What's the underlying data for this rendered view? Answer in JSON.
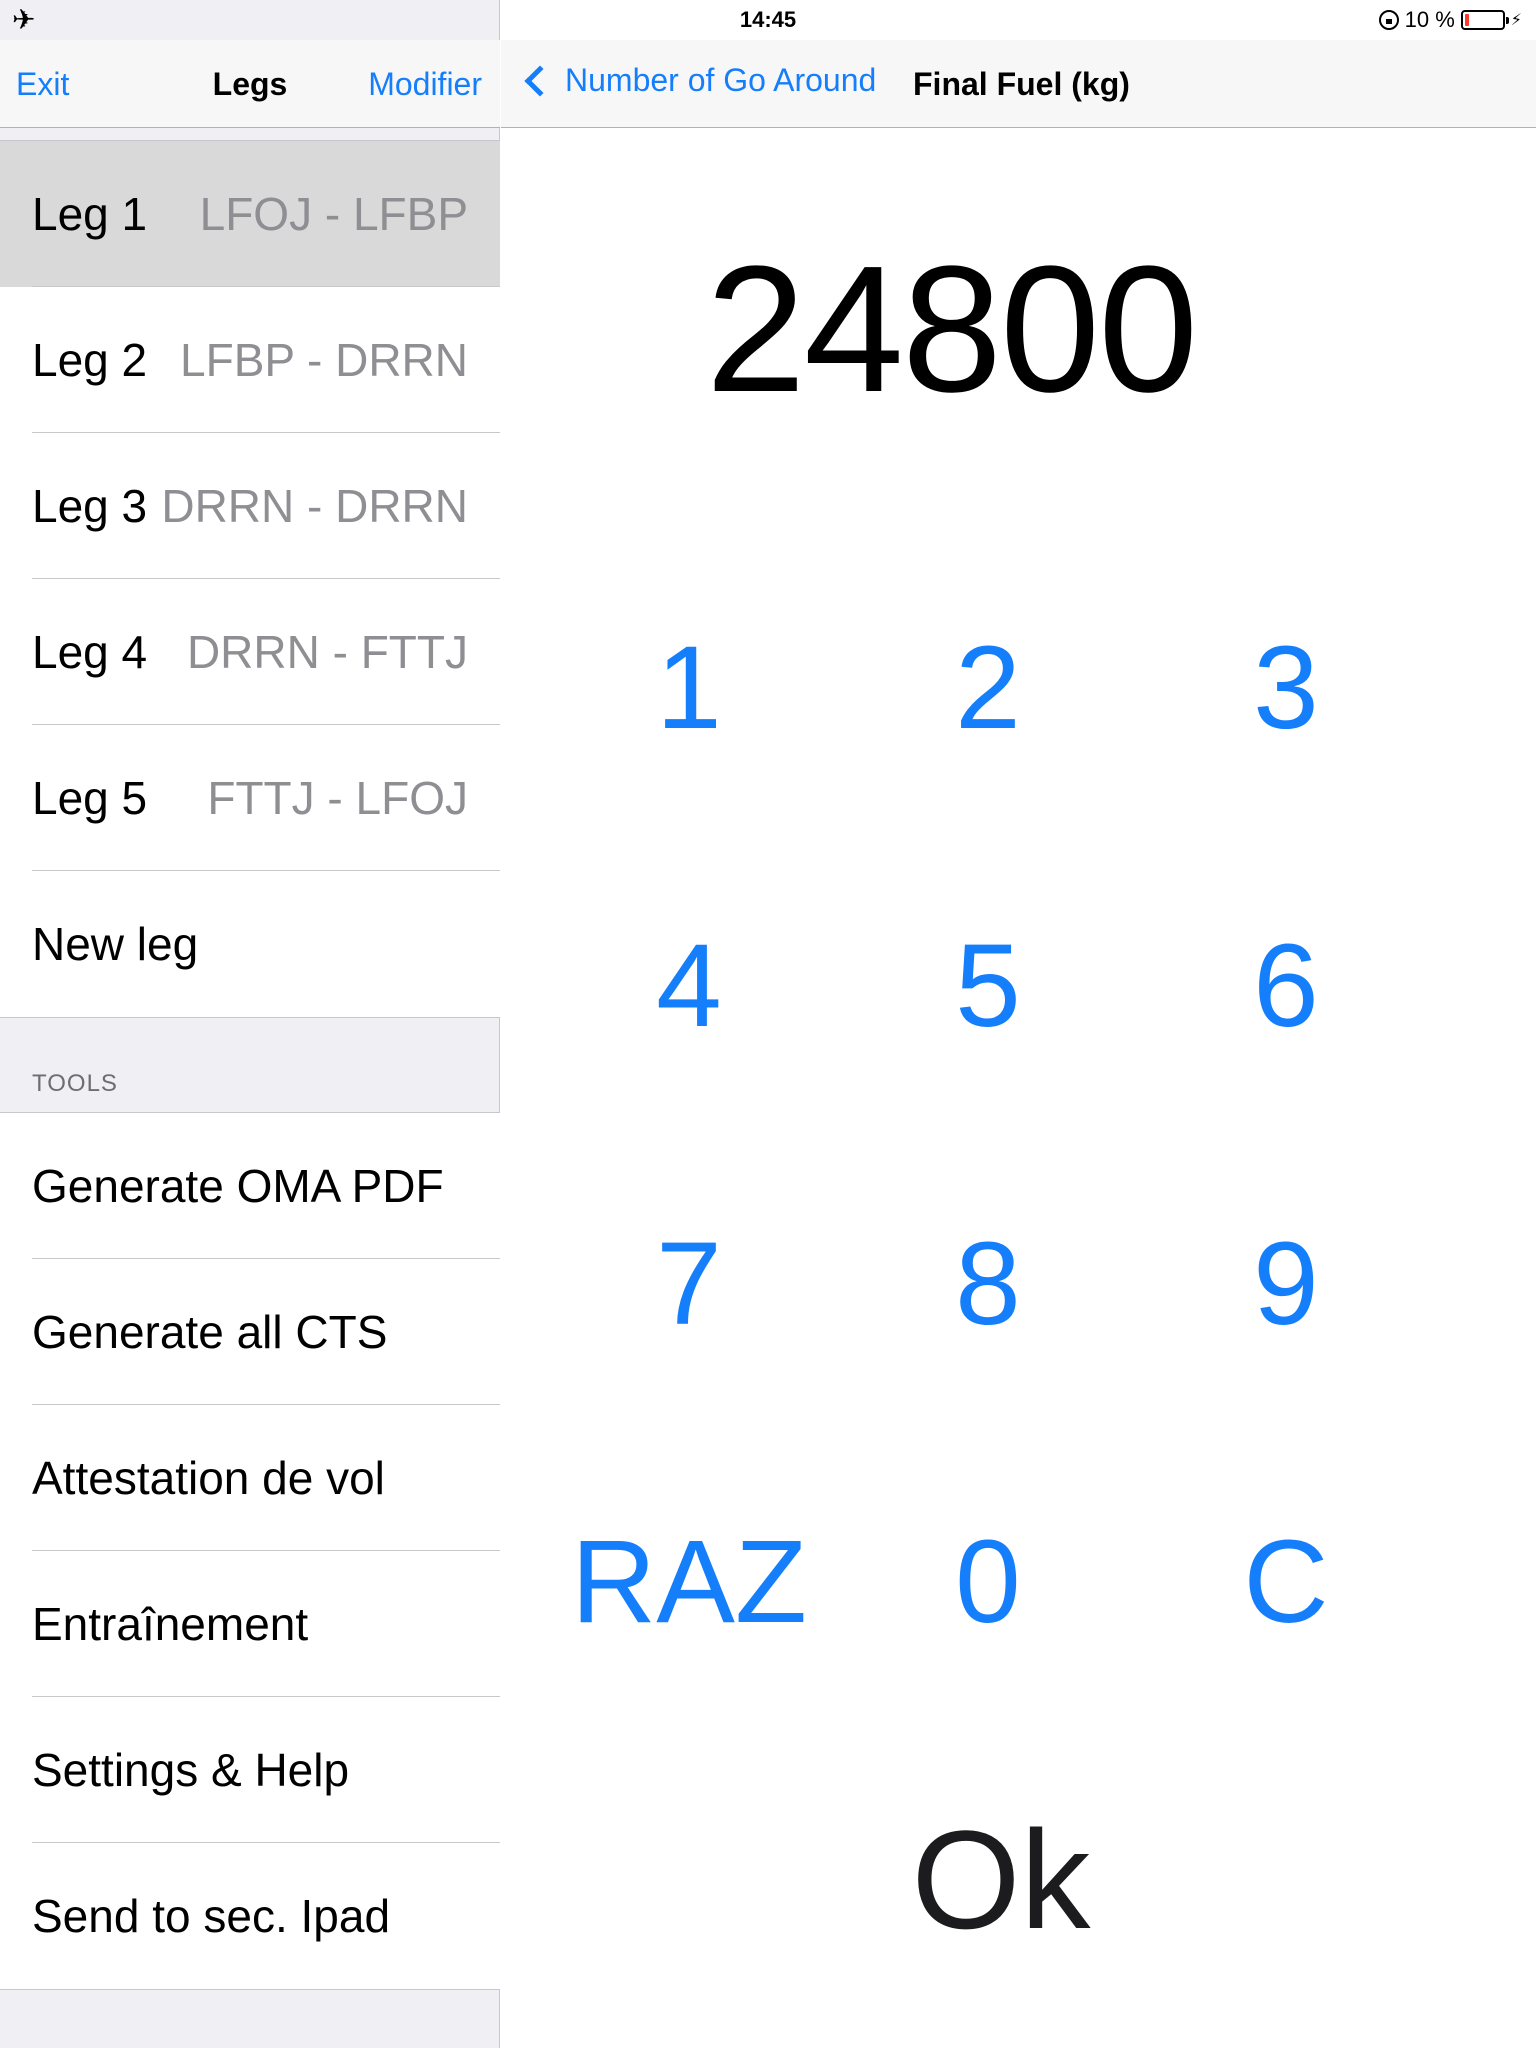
{
  "status_bar": {
    "time": "14:45",
    "battery_text": "10 %",
    "battery_level": 0.1
  },
  "master": {
    "nav": {
      "left_button": "Exit",
      "title": "Legs",
      "right_button": "Modifier"
    },
    "legs": [
      {
        "label": "Leg 1",
        "route": "LFOJ - LFBP",
        "selected": true
      },
      {
        "label": "Leg 2",
        "route": "LFBP - DRRN"
      },
      {
        "label": "Leg 3",
        "route": "DRRN - DRRN"
      },
      {
        "label": "Leg 4",
        "route": "DRRN - FTTJ"
      },
      {
        "label": "Leg 5",
        "route": "FTTJ - LFOJ"
      },
      {
        "label": "New leg"
      }
    ],
    "tools_header": "TOOLS",
    "tools": [
      {
        "label": "Generate OMA PDF"
      },
      {
        "label": "Generate all CTS"
      },
      {
        "label": "Attestation de vol"
      },
      {
        "label": "Entraînement"
      },
      {
        "label": "Settings & Help"
      },
      {
        "label": "Send to sec. Ipad"
      }
    ]
  },
  "detail": {
    "nav": {
      "back_label": "Number of Go Around",
      "title": "Final Fuel (kg)"
    },
    "display_value": "24800",
    "keys": {
      "k1": "1",
      "k2": "2",
      "k3": "3",
      "k4": "4",
      "k5": "5",
      "k6": "6",
      "k7": "7",
      "k8": "8",
      "k9": "9",
      "raz": "RAZ",
      "k0": "0",
      "clear": "C"
    },
    "ok_label": "Ok"
  },
  "colors": {
    "accent": "#157efb",
    "selected_row": "#d9d9d9",
    "secondary_text": "#8e8e93",
    "battery_low": "#ff3b30"
  }
}
